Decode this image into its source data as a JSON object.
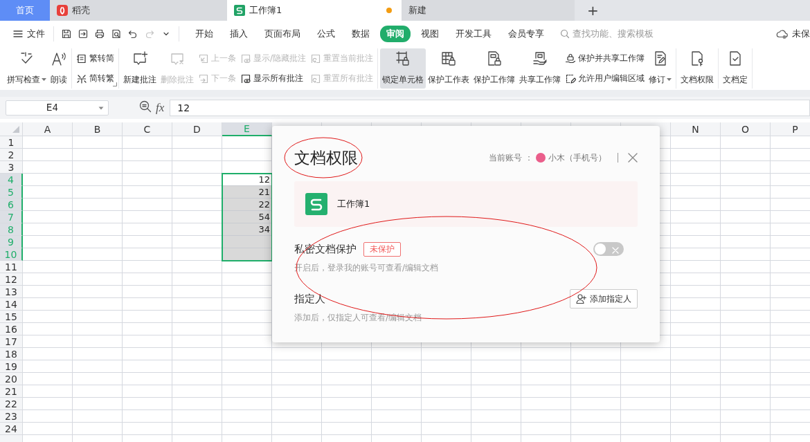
{
  "tabs": [
    {
      "kind": "home",
      "label": "首页",
      "selected": false
    },
    {
      "kind": "docer",
      "label": "稻壳",
      "selected": false
    },
    {
      "kind": "sheet",
      "label": "工作簿1",
      "selected": true,
      "unsaved": true
    },
    {
      "kind": "new",
      "label": "新建",
      "selected": false
    }
  ],
  "new_tab": "+",
  "menu": {
    "file": "文件",
    "quick_access": [
      {
        "disabled": false
      },
      {
        "disabled": false
      },
      {
        "disabled": false
      },
      {
        "disabled": false
      },
      {
        "disabled": false
      },
      {
        "disabled": true
      },
      {
        "disabled": false
      }
    ],
    "tabs": [
      {
        "label": "开始",
        "selected": false
      },
      {
        "label": "插入",
        "selected": false
      },
      {
        "label": "页面布局",
        "selected": false
      },
      {
        "label": "公式",
        "selected": false
      },
      {
        "label": "数据",
        "selected": false
      },
      {
        "label": "审阅",
        "selected": true
      },
      {
        "label": "视图",
        "selected": false
      },
      {
        "label": "开发工具",
        "selected": false
      },
      {
        "label": "会员专享",
        "selected": false
      }
    ],
    "search": {
      "placeholder": "查找功能、搜索模板"
    },
    "cloud_status": "未保"
  },
  "ribbon": {
    "groups": [
      {
        "columns": [
          {
            "kind": "large",
            "label": "拼写检查",
            "disabled": false,
            "selected": false,
            "dropdown": true
          },
          {
            "kind": "large",
            "label": "朗读",
            "disabled": false,
            "selected": false,
            "dropdown": false
          }
        ]
      },
      {
        "launcher": true,
        "columns": [
          {
            "kind": "stack",
            "items": [
              {
                "label": "繁转简",
                "disabled": false
              },
              {
                "label": "简转繁",
                "disabled": false
              }
            ]
          }
        ]
      },
      {
        "columns": [
          {
            "kind": "large",
            "label": "新建批注",
            "disabled": false,
            "selected": false,
            "dropdown": false
          },
          {
            "kind": "large",
            "label": "删除批注",
            "disabled": true,
            "selected": false,
            "dropdown": false
          },
          {
            "kind": "stack",
            "items": [
              {
                "label": "上一条",
                "disabled": true
              },
              {
                "label": "下一条",
                "disabled": true
              }
            ]
          },
          {
            "kind": "stack",
            "items": [
              {
                "label": "显示/隐藏批注",
                "disabled": true
              },
              {
                "label": "显示所有批注",
                "disabled": false
              }
            ]
          },
          {
            "kind": "stack",
            "items": [
              {
                "label": "重置当前批注",
                "disabled": true
              },
              {
                "label": "重置所有批注",
                "disabled": true
              }
            ]
          }
        ]
      },
      {
        "columns": [
          {
            "kind": "large",
            "label": "锁定单元格",
            "disabled": false,
            "selected": true,
            "dropdown": false
          },
          {
            "kind": "large",
            "label": "保护工作表",
            "disabled": false,
            "selected": false,
            "dropdown": false
          },
          {
            "kind": "large",
            "label": "保护工作簿",
            "disabled": false,
            "selected": false,
            "dropdown": false
          },
          {
            "kind": "large",
            "label": "共享工作簿",
            "disabled": false,
            "selected": false,
            "dropdown": false
          },
          {
            "kind": "stack",
            "items": [
              {
                "label": "保护并共享工作簿",
                "disabled": false
              },
              {
                "label": "允许用户编辑区域",
                "disabled": false
              }
            ]
          },
          {
            "kind": "large",
            "label": "修订",
            "disabled": false,
            "selected": false,
            "dropdown": true
          }
        ]
      },
      {
        "columns": [
          {
            "kind": "large",
            "label": "文档权限",
            "disabled": false,
            "selected": false,
            "dropdown": false
          }
        ]
      },
      {
        "columns": [
          {
            "kind": "large",
            "label": "文档定",
            "disabled": false,
            "selected": false,
            "dropdown": false
          }
        ]
      }
    ]
  },
  "formula_bar": {
    "cell": "E4",
    "fx": "fx",
    "value": "12"
  },
  "sheet": {
    "columns": [
      {
        "label": "A",
        "selected": false
      },
      {
        "label": "B",
        "selected": false
      },
      {
        "label": "C",
        "selected": false
      },
      {
        "label": "D",
        "selected": false
      },
      {
        "label": "E",
        "selected": true
      },
      {
        "selected": false
      },
      {
        "selected": false
      },
      {
        "selected": false
      },
      {
        "selected": false
      },
      {
        "selected": false
      },
      {
        "selected": false
      },
      {
        "selected": false
      },
      {
        "selected": false
      },
      {
        "label": "N",
        "selected": false
      },
      {
        "label": "O",
        "selected": false
      },
      {
        "label": "P",
        "selected": false
      }
    ],
    "rows": [
      {
        "header": "1",
        "selected": false
      },
      {
        "header": "2",
        "selected": false
      },
      {
        "header": "3",
        "selected": false
      },
      {
        "header": "4",
        "selected": true,
        "cells": [
          null,
          null,
          null,
          null,
          {
            "text": "12",
            "active": true
          }
        ]
      },
      {
        "header": "5",
        "selected": true,
        "cells": [
          null,
          null,
          null,
          null,
          {
            "text": "21",
            "active": false
          }
        ]
      },
      {
        "header": "6",
        "selected": true,
        "cells": [
          null,
          null,
          null,
          null,
          {
            "text": "22",
            "active": false
          }
        ]
      },
      {
        "header": "7",
        "selected": true,
        "cells": [
          null,
          null,
          null,
          null,
          {
            "text": "54",
            "active": false
          }
        ]
      },
      {
        "header": "8",
        "selected": true,
        "cells": [
          null,
          null,
          null,
          null,
          {
            "text": "34",
            "active": false
          }
        ]
      },
      {
        "header": "9",
        "selected": true
      },
      {
        "header": "10",
        "selected": true
      },
      {
        "header": "11",
        "selected": false
      },
      {
        "header": "12",
        "selected": false
      },
      {
        "header": "13",
        "selected": false
      },
      {
        "header": "14",
        "selected": false
      },
      {
        "header": "15",
        "selected": false
      },
      {
        "header": "16",
        "selected": false
      },
      {
        "header": "17",
        "selected": false
      },
      {
        "header": "18",
        "selected": false
      },
      {
        "header": "19",
        "selected": false
      },
      {
        "header": "20",
        "selected": false
      },
      {
        "header": "21",
        "selected": false
      },
      {
        "header": "22",
        "selected": false
      },
      {
        "header": "23",
        "selected": false
      },
      {
        "header": "24",
        "selected": false
      },
      {
        "selected": false
      }
    ]
  },
  "dialog": {
    "title": "文档权限",
    "account_label": "当前账号 ：",
    "account_name": "小木（手机号）",
    "file": {
      "name": "工作簿1"
    },
    "sections": [
      {
        "kind": "toggle",
        "title": "私密文档保护",
        "badge": "未保护",
        "description": "开启后，登录我的账号可查看/编辑文档",
        "on": false
      },
      {
        "kind": "button",
        "title": "指定人",
        "description": "添加后，仅指定人可查看/编辑文档",
        "button": "添加指定人"
      }
    ]
  }
}
